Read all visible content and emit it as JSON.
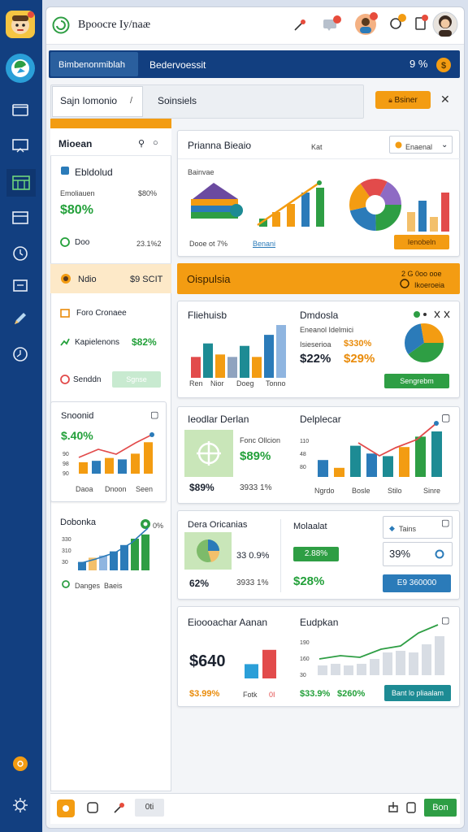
{
  "colors": {
    "sidebar": "#123f80",
    "accent": "#f39c12",
    "green": "#2e9e44",
    "blue": "#2b7bb9",
    "teal": "#1d8b94",
    "red": "#e24b4b"
  },
  "app": {
    "title": "Bpoocre Iy/naæ"
  },
  "topbar": {
    "icons": [
      "pin-icon",
      "message-icon",
      "avatar-badge-icon",
      "alert-icon",
      "document-icon",
      "user-avatar"
    ]
  },
  "header": {
    "tab1": "Bimbenonmiblah",
    "tab2": "Bedervoessit",
    "pct": "9 %"
  },
  "search": {
    "field1": "Sajn Iomonio",
    "field2": "Soinsiels",
    "button": "Bsiner"
  },
  "left": {
    "p1": {
      "title": "Mioean",
      "row1": "Ebldolud",
      "label": "Emoliauen",
      "pct": "$80%",
      "value": "$80%",
      "bottom_label": "Doo",
      "bottom_value": "23.1%2"
    },
    "p2": {
      "title": "Ndio",
      "value": "$9 SCIT",
      "row1": "Foro Cronaee",
      "row2": "Kapielenons",
      "row2_value": "$82%",
      "row3": "Senddn",
      "button": "Sgnse"
    },
    "p3": {
      "title": "Snoonid",
      "value": "$.40%",
      "ticks": [
        "90",
        "98",
        "90"
      ],
      "cats": [
        "Daoa",
        "Dnoon",
        "Seen"
      ]
    },
    "p4": {
      "title": "Dobonka",
      "badge": "0%",
      "ticks": [
        "330",
        "310",
        "30"
      ],
      "legend": [
        "Danges",
        "Baeis"
      ]
    }
  },
  "c1": {
    "title": "Prianna Bieaio",
    "label": "Kat",
    "dropdown": "Enaenal",
    "sub": "Bainvae",
    "bottom1": "Dooe ot 7%",
    "bottom2": "Benani",
    "button": "Ienobeln"
  },
  "banner": {
    "title": "Oispulsia",
    "r1": "2 G 0oo ooe",
    "r2": "Ikoeroeia"
  },
  "c2": {
    "title": "Fliehuisb",
    "cats": [
      "Ren",
      "Nior",
      "Doeg",
      "Tonno"
    ],
    "title2": "Dmdosla",
    "sub": "Eneanol Idelmici",
    "label": "Isieserioa",
    "pct": "$330%",
    "v1": "$22%",
    "v2": "$29%",
    "button": "Sengrebm"
  },
  "c3": {
    "title": "Ieodlar Derlan",
    "sub": "Fonc Ollcion",
    "big": "$89%",
    "v1": "$89%",
    "v2": "3933 1%",
    "title2": "Delplecar",
    "ticks": [
      "110",
      "48",
      "80"
    ],
    "cats": [
      "Ngrdo",
      "Bosle",
      "Stilo",
      "Sinre"
    ]
  },
  "c4": {
    "title": "Dera Oricanias",
    "v1": "33 0.9%",
    "v2": "3933 1%",
    "big": "62%",
    "title2": "Molaalat",
    "badge": "2.88%",
    "pct": "$28%",
    "box_title": "Tains",
    "box_pct": "39%",
    "button": "E9 360000"
  },
  "c5": {
    "title": "Eioooachar Aanan",
    "big": "$640",
    "label": "Fotk",
    "label2": "0I",
    "bottom": "$3.99%",
    "title2": "Eudpkan",
    "ticks": [
      "190",
      "160",
      "30"
    ],
    "g1": "$33.9%",
    "g2": "$260%",
    "button": "Bant lo pliaalam"
  },
  "footer": {
    "tag": "0ti",
    "button": "Bon"
  },
  "chart_data": [
    {
      "type": "bar",
      "categories": [
        "Daoa",
        "Dnoon",
        "Seen"
      ],
      "values": [
        16,
        18,
        22,
        20,
        28,
        44
      ],
      "title": "Snoonid"
    },
    {
      "type": "bar",
      "categories": [
        "Danges",
        "Baeis"
      ],
      "values": [
        8,
        12,
        14,
        18,
        24,
        30,
        34
      ],
      "title": "Dobonka"
    },
    {
      "type": "bar",
      "categories": [
        "Ren",
        "Nior",
        "Doeg",
        "Tonno"
      ],
      "values": [
        34,
        56,
        38,
        34,
        52,
        34,
        70,
        86
      ],
      "title": "Fliehuisb"
    },
    {
      "type": "bar",
      "categories": [
        "Ngrdo",
        "Bosle",
        "Stilo",
        "Sinre"
      ],
      "values": [
        26,
        14,
        48,
        36,
        32,
        46,
        62,
        70
      ],
      "title": "Delplecar"
    },
    {
      "type": "bar",
      "title": "Eioooachar Aanan",
      "values": [
        22,
        44
      ]
    },
    {
      "type": "bar",
      "title": "Eudpkan",
      "values": [
        12,
        14,
        12,
        14,
        20,
        28,
        30,
        28,
        38,
        48
      ]
    }
  ]
}
